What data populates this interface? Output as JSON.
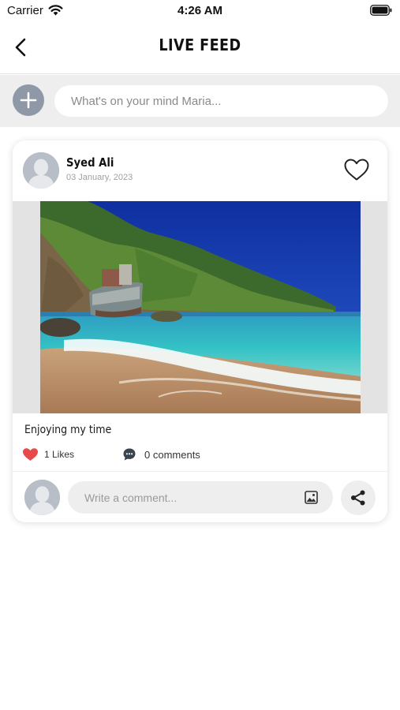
{
  "status_bar": {
    "carrier": "Carrier",
    "time": "4:26 AM",
    "icons": [
      "wifi-icon",
      "battery-icon"
    ]
  },
  "nav": {
    "title": "LIVE FEED",
    "back_icon": "chevron-left-icon"
  },
  "composer": {
    "add_icon": "plus-icon",
    "placeholder": "What's on your mind Maria..."
  },
  "post": {
    "author_name": "Syed Ali",
    "date": "03 January, 2023",
    "caption": "Enjoying my time",
    "likes_label": "1 Likes",
    "comments_label": "0 comments",
    "liked": true,
    "image_subject": "beach-with-shipwreck-photo"
  },
  "comment_box": {
    "placeholder": "Write a comment...",
    "attach_icon": "image-icon",
    "share_icon": "share-icon"
  },
  "colors": {
    "like_red": "#e84a4a",
    "avatar_gray": "#b8bec8",
    "add_button_gray": "#8e98a6",
    "composer_bg": "#eeeeee"
  }
}
